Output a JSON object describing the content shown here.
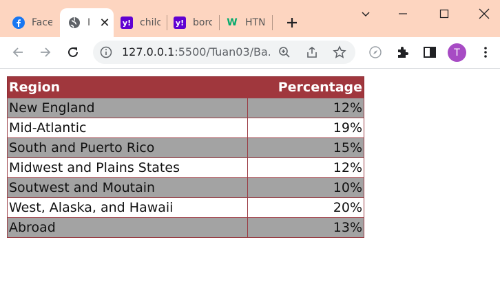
{
  "browser": {
    "tabs": [
      {
        "label": "Face",
        "icon": "facebook-icon"
      },
      {
        "label": "I",
        "icon": "globe-icon"
      },
      {
        "label": "chilc",
        "icon": "yahoo-icon"
      },
      {
        "label": "borc",
        "icon": "yahoo-icon"
      },
      {
        "label": "HTN",
        "icon": "w3schools-icon"
      }
    ],
    "url_host": "127.0.0.1",
    "url_rest": ":5500/Tuan03/Ba...",
    "profile_initial": "T",
    "colors": {
      "tabstrip": "#fdd5c0",
      "avatar": "#a74bc4"
    }
  },
  "table": {
    "headers": {
      "region": "Region",
      "percentage": "Percentage"
    },
    "rows": [
      {
        "region": "New England",
        "percentage": "12%"
      },
      {
        "region": "Mid-Atlantic",
        "percentage": "19%"
      },
      {
        "region": "South and Puerto Rico",
        "percentage": "15%"
      },
      {
        "region": "Midwest and Plains States",
        "percentage": "12%"
      },
      {
        "region": "Soutwest and Moutain",
        "percentage": "10%"
      },
      {
        "region": "West, Alaska, and Hawaii",
        "percentage": "20%"
      },
      {
        "region": "Abroad",
        "percentage": "13%"
      }
    ],
    "colors": {
      "header": "#a0373d",
      "stripe": "#a3a3a3",
      "border": "#9a3a42"
    }
  }
}
